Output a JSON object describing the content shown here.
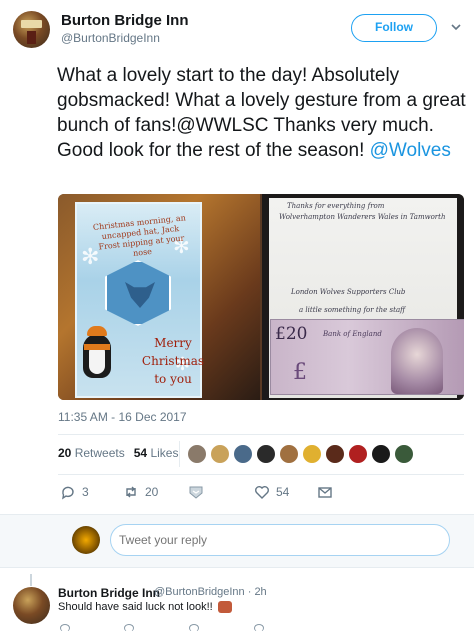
{
  "author": {
    "name": "Burton Bridge Inn",
    "handle": "@BurtonBridgeInn"
  },
  "follow_label": "Follow",
  "tweet": {
    "text_part1": "What a lovely start to the day! Absolutely gobsmacked! What a lovely gesture from a great bunch of fans!@WWLSC Thanks very much. Good look for the rest of the season! ",
    "mention": "@Wolves"
  },
  "media": {
    "card_top_text": "Christmas morning, an uncapped hat, Jack Frost nipping at your nose",
    "card_greeting": "Merry Christmas to you",
    "letter_lines": [
      "Thanks for everything from",
      "Wolverhampton Wanderers Wales in Tamworth",
      "London Wolves Supporters Club",
      "a little something for the staff"
    ],
    "banknote_value": "£20",
    "banknote_issuer": "Bank of England"
  },
  "timestamp": "11:35 AM - 16 Dec 2017",
  "stats": {
    "retweets_count": "20",
    "retweets_label": "Retweets",
    "likes_count": "54",
    "likes_label": "Likes"
  },
  "likers": [
    "#8a7a6a",
    "#c9a25a",
    "#4a6a8a",
    "#2a2a2a",
    "#a07040",
    "#e0b030",
    "#5a2a1a",
    "#b02020",
    "#1a1a1a",
    "#3a5a3a"
  ],
  "actions": {
    "reply_count": "3",
    "retweet_count": "20",
    "like_count": "54"
  },
  "reply_box": {
    "placeholder": "Tweet your reply"
  },
  "reply_tweet": {
    "name": "Burton Bridge Inn",
    "handle_time": "@BurtonBridgeInn · 2h",
    "text": "Should have said luck not look!!"
  },
  "colors": {
    "accent": "#1da1f2",
    "link": "#1b95e0",
    "muted": "#657786"
  }
}
